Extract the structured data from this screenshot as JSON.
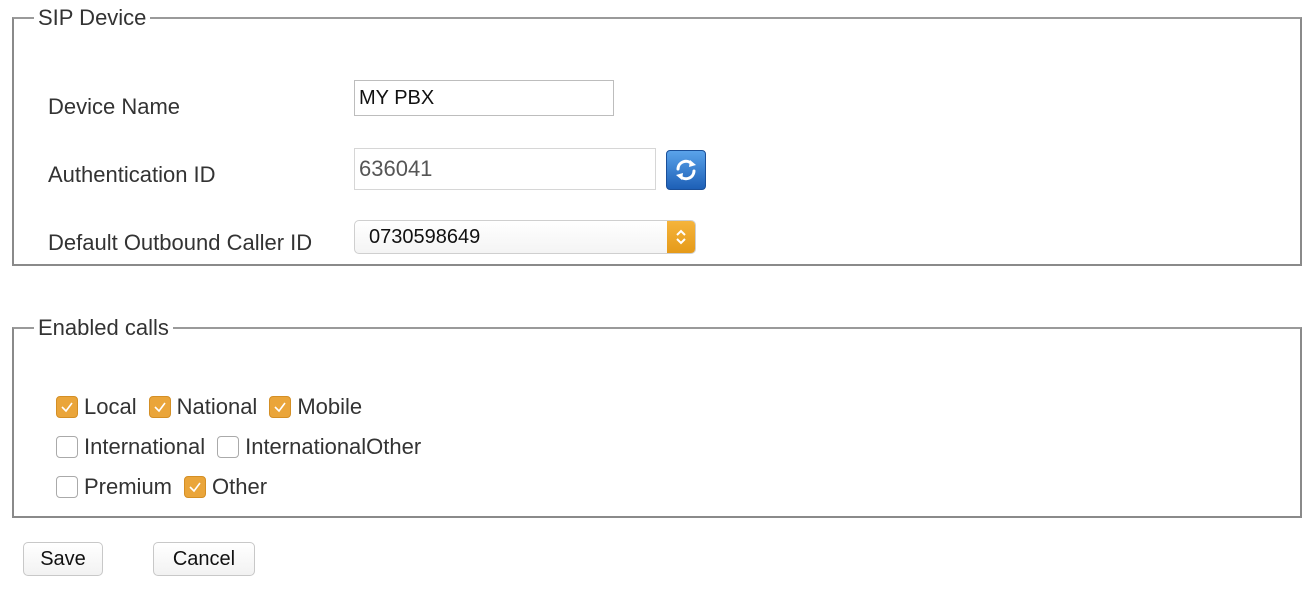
{
  "sip_device": {
    "legend": "SIP Device",
    "device_name_label": "Device Name",
    "device_name_value": "MY PBX",
    "auth_id_label": "Authentication ID",
    "auth_id_value": "636041",
    "caller_id_label": "Default Outbound Caller ID",
    "caller_id_value": "0730598649"
  },
  "enabled_calls": {
    "legend": "Enabled calls",
    "options": [
      {
        "label": "Local",
        "checked": true
      },
      {
        "label": "National",
        "checked": true
      },
      {
        "label": "Mobile",
        "checked": true
      },
      {
        "label": "International",
        "checked": false
      },
      {
        "label": "InternationalOther",
        "checked": false
      },
      {
        "label": "Premium",
        "checked": false
      },
      {
        "label": "Other",
        "checked": true
      }
    ]
  },
  "actions": {
    "save_label": "Save",
    "cancel_label": "Cancel"
  },
  "colors": {
    "check_accent": "#eaa53a",
    "refresh_blue": "#2f7fd6"
  },
  "icons": {
    "refresh": "refresh-icon",
    "select_arrows": "chevron-updown-icon",
    "check": "check-icon"
  }
}
